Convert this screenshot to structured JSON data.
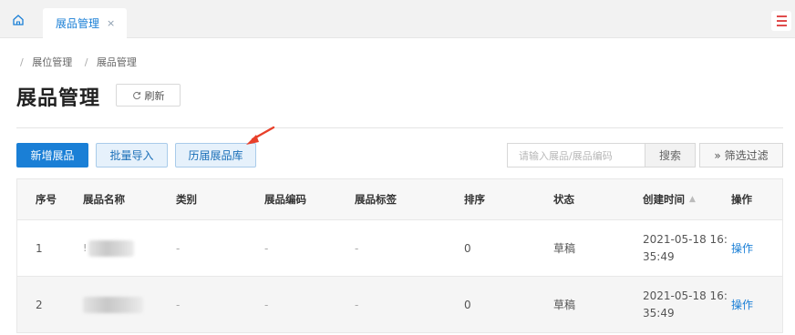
{
  "tabs": {
    "active_label": "展品管理",
    "close_glyph": "×"
  },
  "breadcrumb": {
    "separator": "/",
    "items": [
      "展位管理",
      "展品管理"
    ]
  },
  "page": {
    "title": "展品管理",
    "refresh_label": "刷新"
  },
  "toolbar": {
    "add_label": "新增展品",
    "import_label": "批量导入",
    "history_label": "历届展品库",
    "search_placeholder": "请输入展品/展品编码",
    "search_label": "搜索",
    "filter_label": "筛选过滤",
    "filter_glyph": "»"
  },
  "table": {
    "columns": [
      "序号",
      "展品名称",
      "类别",
      "展品编码",
      "展品标签",
      "排序",
      "状态",
      "创建时间",
      "操作"
    ],
    "rows": [
      {
        "index": "1",
        "name_fragment": "!",
        "category": "-",
        "code": "-",
        "tag": "-",
        "sort": "0",
        "status": "草稿",
        "created_line1": "2021-05-18 16:",
        "created_line2": "35:49",
        "action": "操作"
      },
      {
        "index": "2",
        "name_fragment": "",
        "category": "-",
        "code": "-",
        "tag": "-",
        "sort": "0",
        "status": "草稿",
        "created_line1": "2021-05-18 16:",
        "created_line2": "35:49",
        "action": "操作"
      }
    ]
  },
  "colors": {
    "primary": "#1a7fd6",
    "menu_accent": "#e04b4b",
    "annotation_arrow": "#e8402a"
  },
  "icons": {
    "home": "home-icon",
    "menu": "hamburger-menu-icon",
    "refresh": "refresh-icon",
    "sort": "sort-icon",
    "arrow": "annotation-arrow-icon"
  }
}
